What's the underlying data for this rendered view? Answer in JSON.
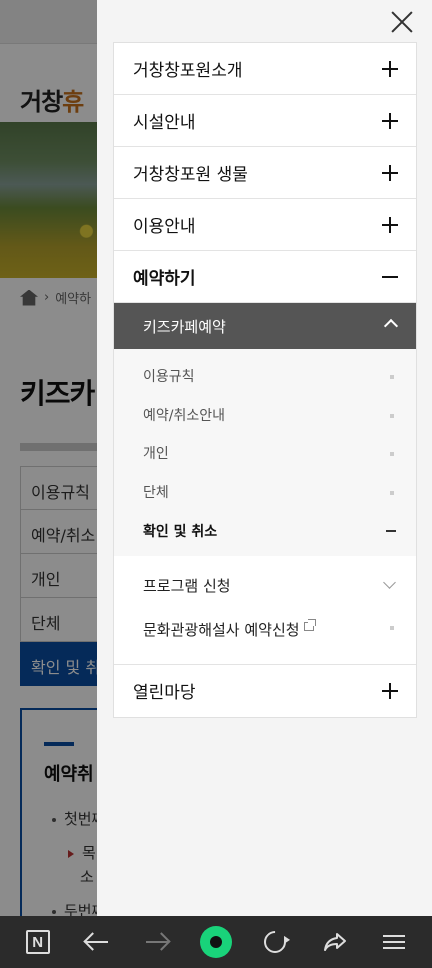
{
  "background_page": {
    "logo_text": "거창",
    "logo_accent": "휴",
    "breadcrumb_label": "예약하",
    "title": "키즈카",
    "tabs": [
      {
        "label": "이용규칙"
      },
      {
        "label": "예약/취소"
      },
      {
        "label": "개인"
      },
      {
        "label": "단체"
      },
      {
        "label": "확인 및 취"
      }
    ],
    "box_title": "예약취",
    "box_lines": [
      "첫번째",
      "목",
      "소",
      "두번째"
    ]
  },
  "menu": {
    "items": [
      {
        "label": "거창창포원소개"
      },
      {
        "label": "시설안내"
      },
      {
        "label": "거창창포원 생물"
      },
      {
        "label": "이용안내"
      },
      {
        "label": "예약하기"
      }
    ],
    "open_sub": {
      "label": "키즈카페예약",
      "items": [
        {
          "label": "이용규칙"
        },
        {
          "label": "예약/취소안내"
        },
        {
          "label": "개인"
        },
        {
          "label": "단체"
        },
        {
          "label": "확인 및 취소"
        }
      ]
    },
    "extra_items": [
      {
        "label": "프로그램 신청"
      },
      {
        "label": "문화관광해설사 예약신청"
      }
    ],
    "last_item": {
      "label": "열린마당"
    }
  },
  "colors": {
    "accent_blue": "#0a4ea2",
    "submenu_header": "#555555",
    "nav_green": "#19d37a"
  },
  "nav_icons": [
    "naver-n-icon",
    "back-arrow-icon",
    "forward-arrow-icon",
    "green-dot-icon",
    "reload-icon",
    "share-icon",
    "hamburger-icon"
  ]
}
